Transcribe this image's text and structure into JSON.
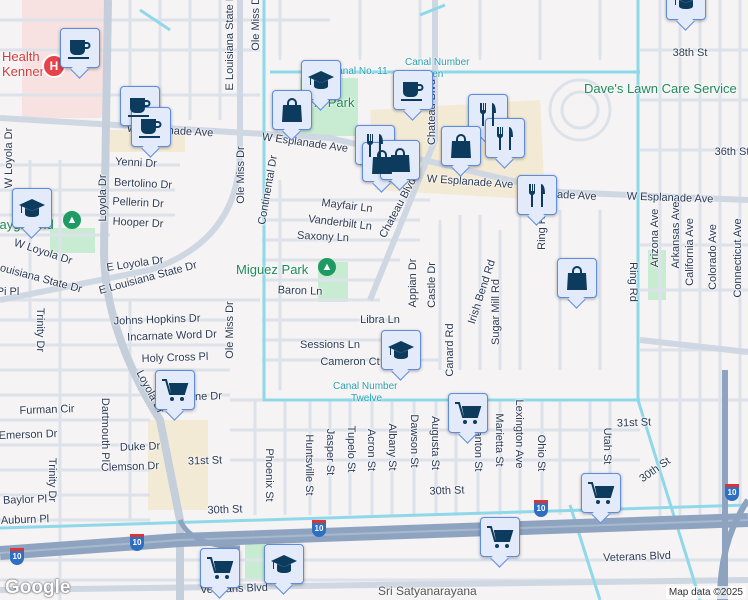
{
  "places": {
    "hospital_line1": "Health",
    "hospital_line2": "Kenner",
    "park_top": "Albino Park",
    "playground": "Playground",
    "miguez_park": "Miguez Park",
    "daves": "Dave's Lawn Care Service",
    "canal_11": "Canal No. 11",
    "canal_seven_1": "Canal Number",
    "canal_seven_2": "Seven",
    "canal_twelve_1": "Canal Number",
    "canal_twelve_2": "Twelve",
    "temple": "Sri Satyanarayana"
  },
  "streets": [
    "W Loyola Dr",
    "Loyola Dr",
    "Yenni Dr",
    "Bertolino Dr",
    "Pellerin Dr",
    "Hooper Dr",
    "W Loyola Dr",
    "Louisiana State Dr",
    "E Loyola Dr",
    "E Louisiana State Dr",
    "E Louisiana State Dr",
    "Ole Miss Dr",
    "Ole Miss Dr",
    "Ole Miss Dr",
    "Continental Dr",
    "W Esplanade Ave",
    "W Esplanade Ave",
    "W Esplanade Ave",
    "Esplanade Ave",
    "W Esplanade Ave",
    "Mayfair Ln",
    "Vanderbilt Ln",
    "Saxony Ln",
    "Baron Ln",
    "Chateau Blvd",
    "Chateau Blvd",
    "Appian Dr",
    "Castle Dr",
    "Canard Rd",
    "Irish Bend Rd",
    "Sugar Mill Rd",
    "Ring Rd",
    "Ring Rd",
    "Arizona Ave",
    "Arkansas Ave",
    "California Ave",
    "Colorado Ave",
    "Connecticut Ave",
    "38th St",
    "36th St",
    "Johns Hopkins Dr",
    "Incarnate Word Dr",
    "Holy Cross Pl",
    "Libra Ln",
    "Sessions Ln",
    "Cameron Ct",
    "Trinity Dr",
    "Trinity Dr",
    "Dartmouth Pl",
    "Loyola Dr",
    "Furman Cir",
    "Emerson Dr",
    "Duke Dr",
    "Clemson Dr",
    "31st St",
    "Baylor Pl",
    "Auburn Pl",
    "30th St",
    "Tulane Dr",
    "Phoenix St",
    "Huntsville St",
    "Jasper St",
    "Tupelo St",
    "Acron St",
    "Albany St",
    "Dawson St",
    "Augusta St",
    "Canton St",
    "Marietta St",
    "Lexington Ave",
    "Ohio St",
    "Utah St",
    "31st St",
    "30th St",
    "30th St",
    "Veterans Blvd",
    "Veterans Blvd",
    "Pi Pl"
  ],
  "highway_shield": "10",
  "markers": [
    {
      "type": "coffee"
    },
    {
      "type": "coffee"
    },
    {
      "type": "coffee"
    },
    {
      "type": "school"
    },
    {
      "type": "school"
    },
    {
      "type": "shopping"
    },
    {
      "type": "coffee"
    },
    {
      "type": "restaurant"
    },
    {
      "type": "restaurant"
    },
    {
      "type": "restaurant"
    },
    {
      "type": "restaurant"
    },
    {
      "type": "shopping"
    },
    {
      "type": "shopping"
    },
    {
      "type": "shopping"
    },
    {
      "type": "shopping"
    },
    {
      "type": "school"
    },
    {
      "type": "cart"
    },
    {
      "type": "cart"
    },
    {
      "type": "cart"
    },
    {
      "type": "cart"
    },
    {
      "type": "cart"
    },
    {
      "type": "school"
    }
  ],
  "footer": {
    "logo": "Google",
    "attribution": "Map data ©2025"
  },
  "colors": {
    "marker_icon": "#0d3b5e",
    "marker_bg": "#e3ebfb",
    "water": "#8fd8ea",
    "highway": "#8ea3bf",
    "park": "#c7ecd1"
  }
}
